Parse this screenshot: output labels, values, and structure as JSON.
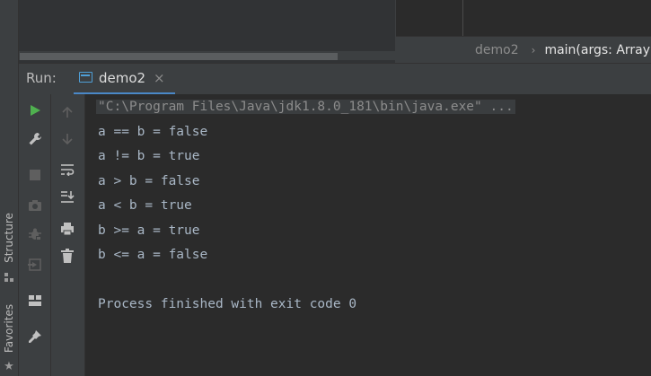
{
  "left_stripe": {
    "structure_label": "Structure",
    "favorites_label": "Favorites"
  },
  "breadcrumb": {
    "items": [
      "demo2",
      "main(args: Array"
    ],
    "separator": "›"
  },
  "run_panel": {
    "label": "Run:",
    "tab": {
      "label": "demo2",
      "close": "×"
    }
  },
  "console": {
    "command": "\"C:\\Program Files\\Java\\jdk1.8.0_181\\bin\\java.exe\" ...",
    "lines": [
      "a == b = false",
      "a != b = true",
      "a > b = false",
      "a < b = true",
      "b >= a = true",
      "b <= a = false"
    ],
    "exit_message": "Process finished with exit code 0"
  },
  "colors": {
    "background": "#2b2b2b",
    "panel": "#3c3f41",
    "text": "#a9b7c6",
    "run_green": "#4fb14f",
    "accent_blue": "#4a88c7"
  },
  "icons": {
    "toolbar_1": [
      "rerun-icon",
      "wrench-icon",
      "stop-icon",
      "camera-icon",
      "debug-bug-icon",
      "exit-icon",
      "layout-icon",
      "pin-icon"
    ],
    "toolbar_2": [
      "up-arrow-icon",
      "down-arrow-icon",
      "soft-wrap-icon",
      "scroll-to-end-icon",
      "print-icon",
      "trash-icon"
    ]
  }
}
